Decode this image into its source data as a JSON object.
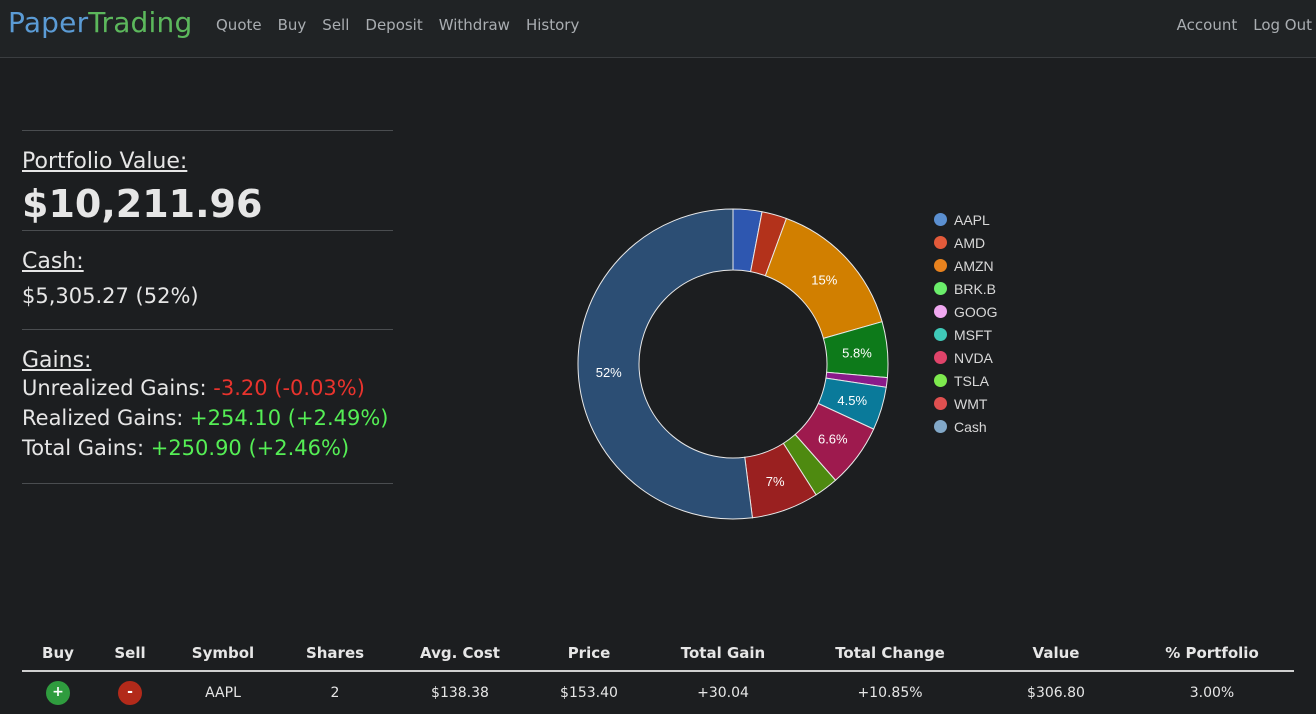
{
  "navbar": {
    "brand_part1": "Paper",
    "brand_part2": "Trading",
    "links": [
      "Quote",
      "Buy",
      "Sell",
      "Deposit",
      "Withdraw",
      "History"
    ],
    "right_links": [
      "Account",
      "Log Out"
    ]
  },
  "summary": {
    "portfolio_label": "Portfolio Value:",
    "portfolio_value": "$10,211.96",
    "cash_label": "Cash:",
    "cash_value": "$5,305.27 (52%)",
    "gains_label": "Gains:",
    "unrealized_label": "Unrealized Gains:",
    "unrealized_value": "-3.20 (-0.03%)",
    "realized_label": "Realized Gains:",
    "realized_value": "+254.10 (+2.49%)",
    "total_label": "Total Gains:",
    "total_value": "+250.90 (+2.46%)"
  },
  "colors": {
    "negative": "#e8332d",
    "positive": "#55ee55",
    "brand_blue": "#5b9bd5",
    "brand_green": "#5cb85c"
  },
  "chart_data": {
    "type": "pie",
    "series": [
      {
        "label": "AAPL",
        "value": 3.0,
        "color": "#2e57b0",
        "legend_color": "#5b8fd0",
        "slice_label": ""
      },
      {
        "label": "AMD",
        "value": 2.6,
        "color": "#b3321b",
        "legend_color": "#e35a3a",
        "slice_label": ""
      },
      {
        "label": "AMZN",
        "value": 15.0,
        "color": "#d17f00",
        "legend_color": "#e8821e",
        "slice_label": "15%"
      },
      {
        "label": "BRK.B",
        "value": 5.8,
        "color": "#0d7a1a",
        "legend_color": "#6bee6b",
        "slice_label": "5.8%"
      },
      {
        "label": "GOOG",
        "value": 1.0,
        "color": "#8a1a8a",
        "legend_color": "#f0a8f0",
        "slice_label": ""
      },
      {
        "label": "MSFT",
        "value": 4.5,
        "color": "#0a7a9a",
        "legend_color": "#3fc9b8",
        "slice_label": "4.5%"
      },
      {
        "label": "NVDA",
        "value": 6.6,
        "color": "#9e1a4e",
        "legend_color": "#e0446a",
        "slice_label": "6.6%"
      },
      {
        "label": "TSLA",
        "value": 2.5,
        "color": "#4e8a10",
        "legend_color": "#7eea4e",
        "slice_label": ""
      },
      {
        "label": "WMT",
        "value": 7.0,
        "color": "#9a2020",
        "legend_color": "#e05050",
        "slice_label": "7%"
      },
      {
        "label": "Cash",
        "value": 52.0,
        "color": "#2c4e74",
        "legend_color": "#82a8c8",
        "slice_label": "52%"
      }
    ]
  },
  "table": {
    "headers": [
      "Buy",
      "Sell",
      "Symbol",
      "Shares",
      "Avg. Cost",
      "Price",
      "Total Gain",
      "Total Change",
      "Value",
      "% Portfolio"
    ],
    "rows": [
      {
        "buy_label": "+",
        "sell_label": "-",
        "symbol": "AAPL",
        "shares": "2",
        "avg_cost": "$138.38",
        "price": "$153.40",
        "total_gain": "+30.04",
        "total_change": "+10.85%",
        "value": "$306.80",
        "pct_portfolio": "3.00%"
      }
    ]
  }
}
